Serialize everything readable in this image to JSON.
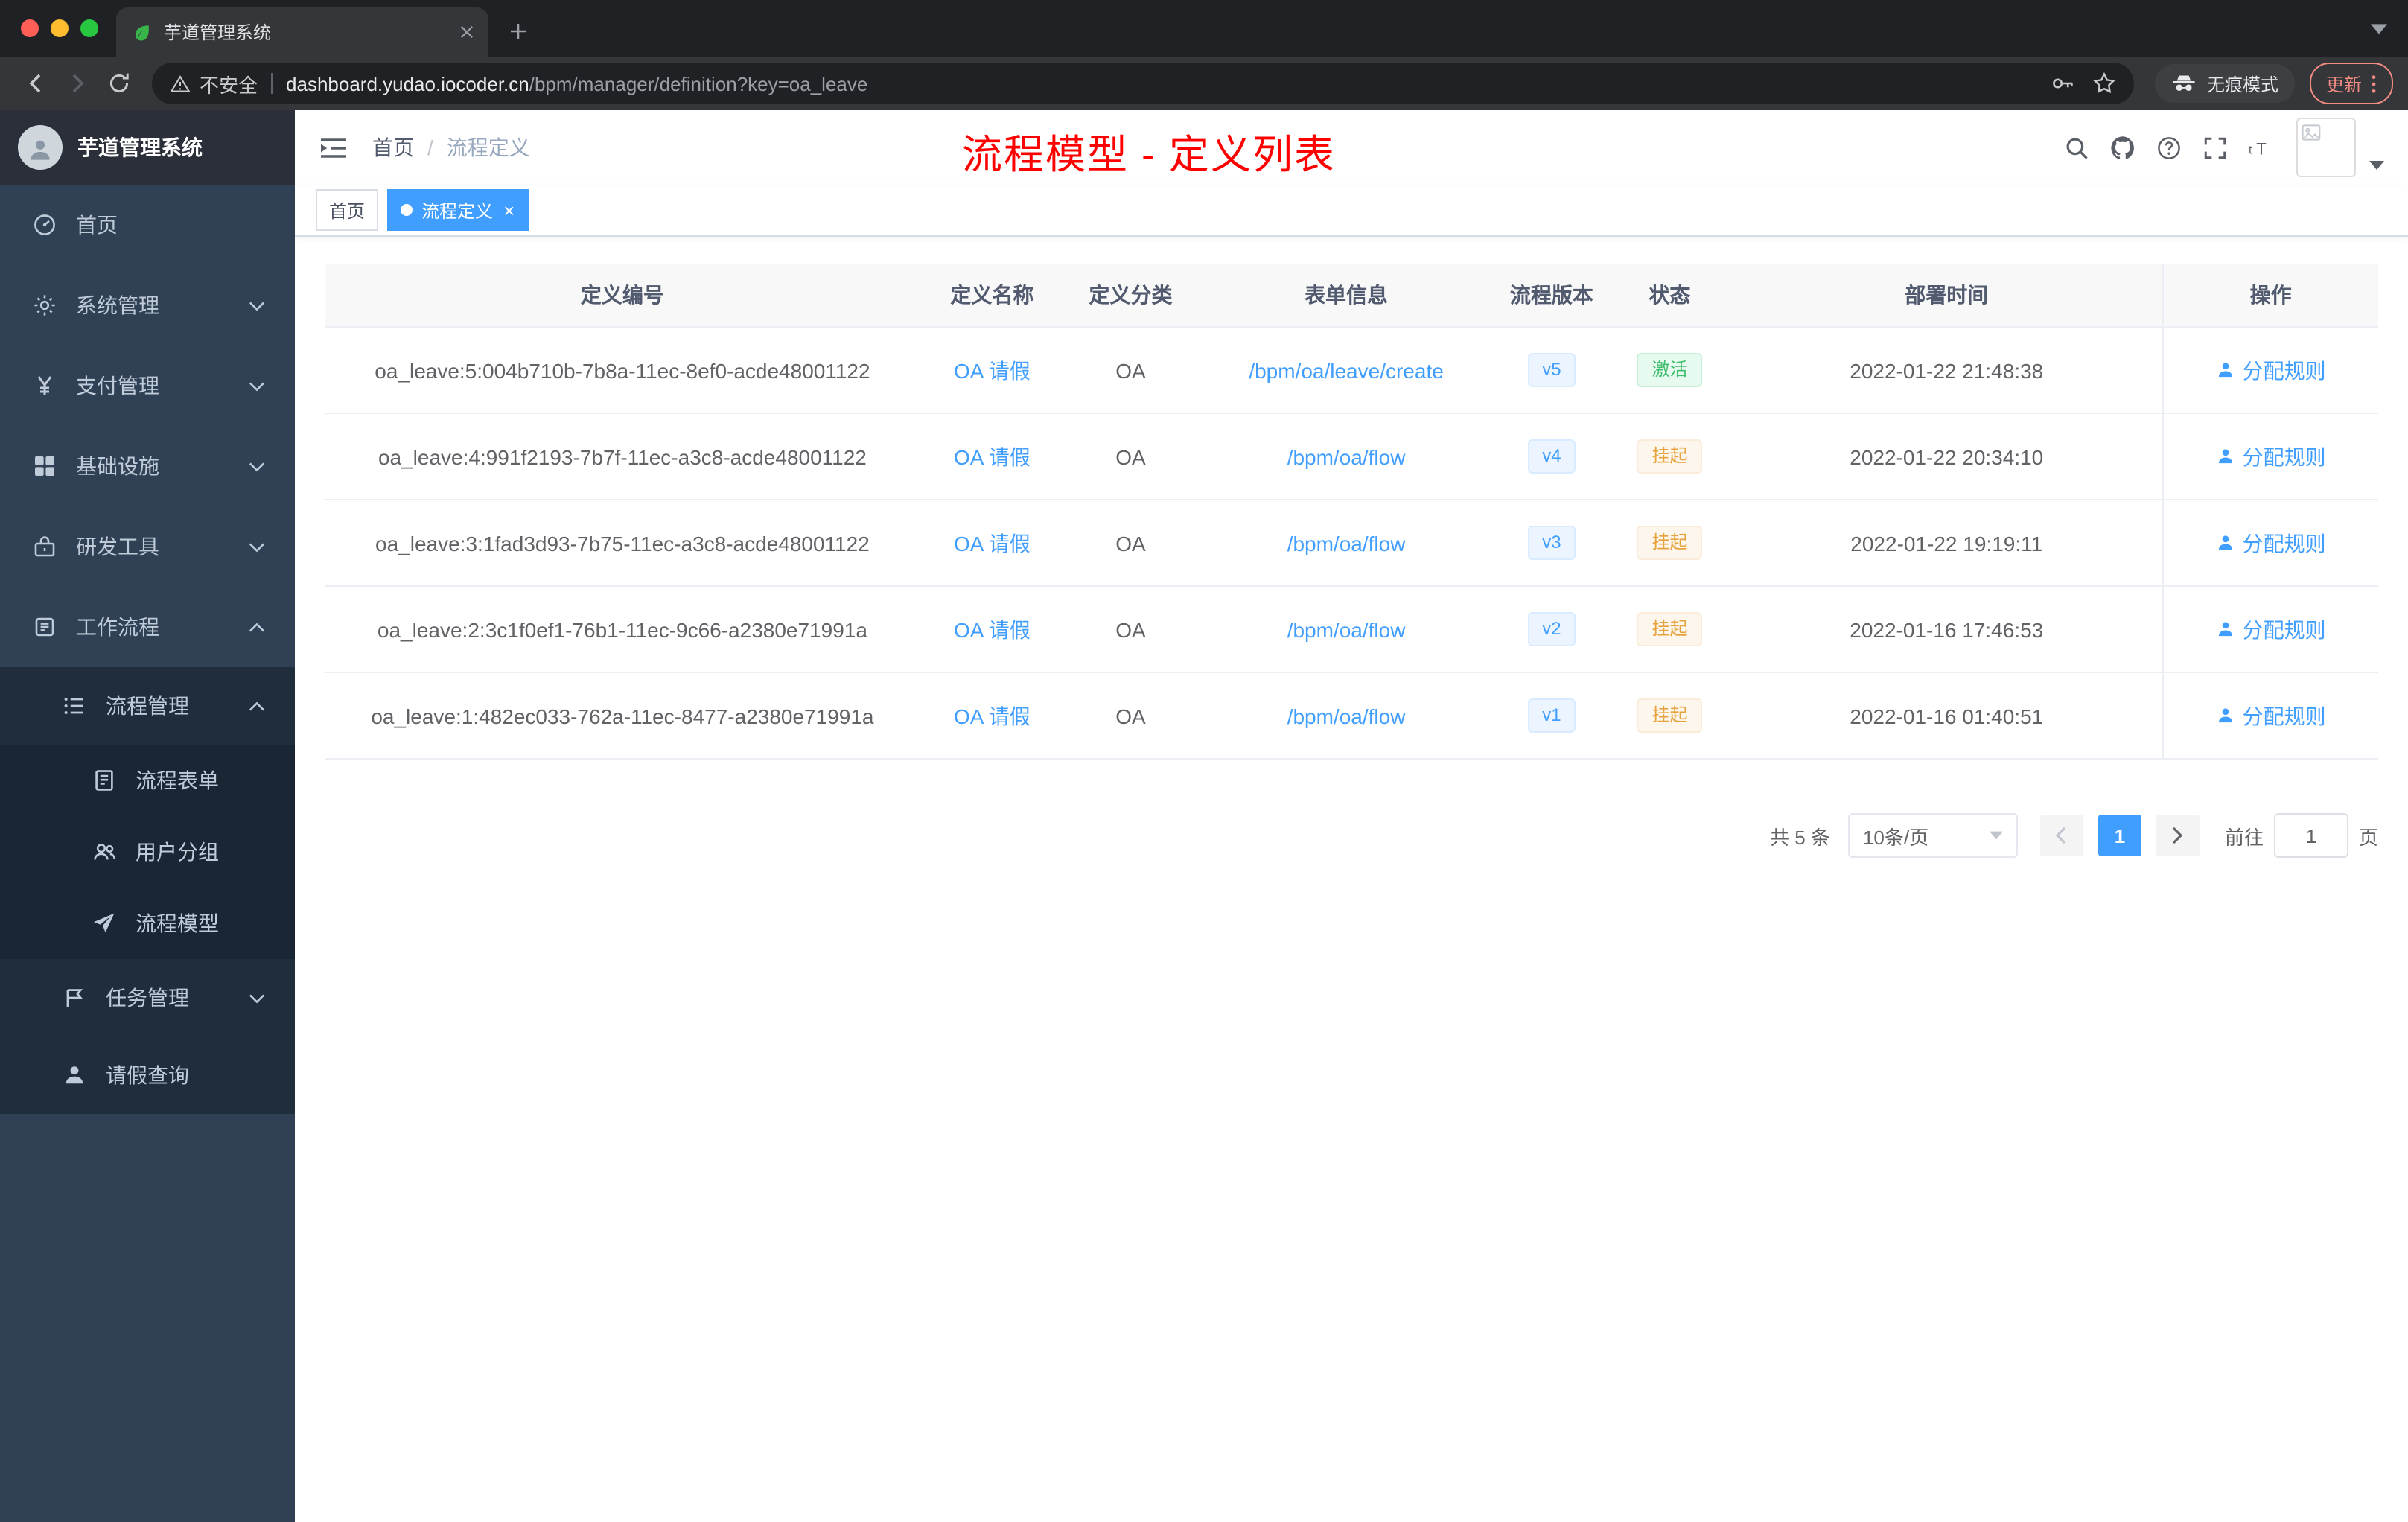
{
  "browser": {
    "tab_title": "芋道管理系统",
    "security_label": "不安全",
    "url_domain": "dashboard.yudao.iocoder.cn",
    "url_path": "/bpm/manager/definition?key=oa_leave",
    "incognito_label": "无痕模式",
    "update_label": "更新"
  },
  "sidebar": {
    "logo_title": "芋道管理系统",
    "items": [
      {
        "key": "home",
        "label": "首页",
        "icon": "dashboard-icon"
      },
      {
        "key": "system-management",
        "label": "系统管理",
        "icon": "gear-icon",
        "collapsed": true
      },
      {
        "key": "payment-management",
        "label": "支付管理",
        "icon": "yen-icon",
        "collapsed": true
      },
      {
        "key": "infrastructure",
        "label": "基础设施",
        "icon": "infra-icon",
        "collapsed": true
      },
      {
        "key": "dev-tools",
        "label": "研发工具",
        "icon": "tools-icon",
        "collapsed": true
      },
      {
        "key": "workflow",
        "label": "工作流程",
        "icon": "workflow-icon",
        "expanded": true,
        "children": [
          {
            "key": "process-management",
            "label": "流程管理",
            "icon": "list-icon",
            "expanded": true,
            "children": [
              {
                "key": "process-form",
                "label": "流程表单",
                "icon": "form-icon"
              },
              {
                "key": "user-group",
                "label": "用户分组",
                "icon": "user-group-icon"
              },
              {
                "key": "process-model",
                "label": "流程模型",
                "icon": "send-icon"
              }
            ]
          },
          {
            "key": "task-management",
            "label": "任务管理",
            "icon": "task-icon",
            "collapsed": true
          },
          {
            "key": "leave-query",
            "label": "请假查询",
            "icon": "person-icon"
          }
        ]
      }
    ]
  },
  "header": {
    "breadcrumb": [
      "首页",
      "流程定义"
    ],
    "breadcrumb_separator": "/",
    "annotation_title": "流程模型 - 定义列表",
    "tools": [
      "search-icon",
      "github-icon",
      "help-icon",
      "fullscreen-icon",
      "font-size-icon"
    ]
  },
  "tags": [
    {
      "label": "首页",
      "active": false
    },
    {
      "label": "流程定义",
      "active": true
    }
  ],
  "table": {
    "columns": [
      "定义编号",
      "定义名称",
      "定义分类",
      "表单信息",
      "流程版本",
      "状态",
      "部署时间",
      "操作"
    ],
    "rows": [
      {
        "id": "oa_leave:5:004b710b-7b8a-11ec-8ef0-acde48001122",
        "name": "OA 请假",
        "category": "OA",
        "form": "/bpm/oa/leave/create",
        "version": "v5",
        "status": "激活",
        "status_type": "success",
        "time": "2022-01-22 21:48:38",
        "action": "分配规则"
      },
      {
        "id": "oa_leave:4:991f2193-7b7f-11ec-a3c8-acde48001122",
        "name": "OA 请假",
        "category": "OA",
        "form": "/bpm/oa/flow",
        "version": "v4",
        "status": "挂起",
        "status_type": "warning",
        "time": "2022-01-22 20:34:10",
        "action": "分配规则"
      },
      {
        "id": "oa_leave:3:1fad3d93-7b75-11ec-a3c8-acde48001122",
        "name": "OA 请假",
        "category": "OA",
        "form": "/bpm/oa/flow",
        "version": "v3",
        "status": "挂起",
        "status_type": "warning",
        "time": "2022-01-22 19:19:11",
        "action": "分配规则"
      },
      {
        "id": "oa_leave:2:3c1f0ef1-76b1-11ec-9c66-a2380e71991a",
        "name": "OA 请假",
        "category": "OA",
        "form": "/bpm/oa/flow",
        "version": "v2",
        "status": "挂起",
        "status_type": "warning",
        "time": "2022-01-16 17:46:53",
        "action": "分配规则"
      },
      {
        "id": "oa_leave:1:482ec033-762a-11ec-8477-a2380e71991a",
        "name": "OA 请假",
        "category": "OA",
        "form": "/bpm/oa/flow",
        "version": "v1",
        "status": "挂起",
        "status_type": "warning",
        "time": "2022-01-16 01:40:51",
        "action": "分配规则"
      }
    ]
  },
  "pagination": {
    "total_text": "共 5 条",
    "page_size": "10条/页",
    "current_page": "1",
    "goto_label": "前往",
    "goto_value": "1",
    "page_unit": "页"
  }
}
